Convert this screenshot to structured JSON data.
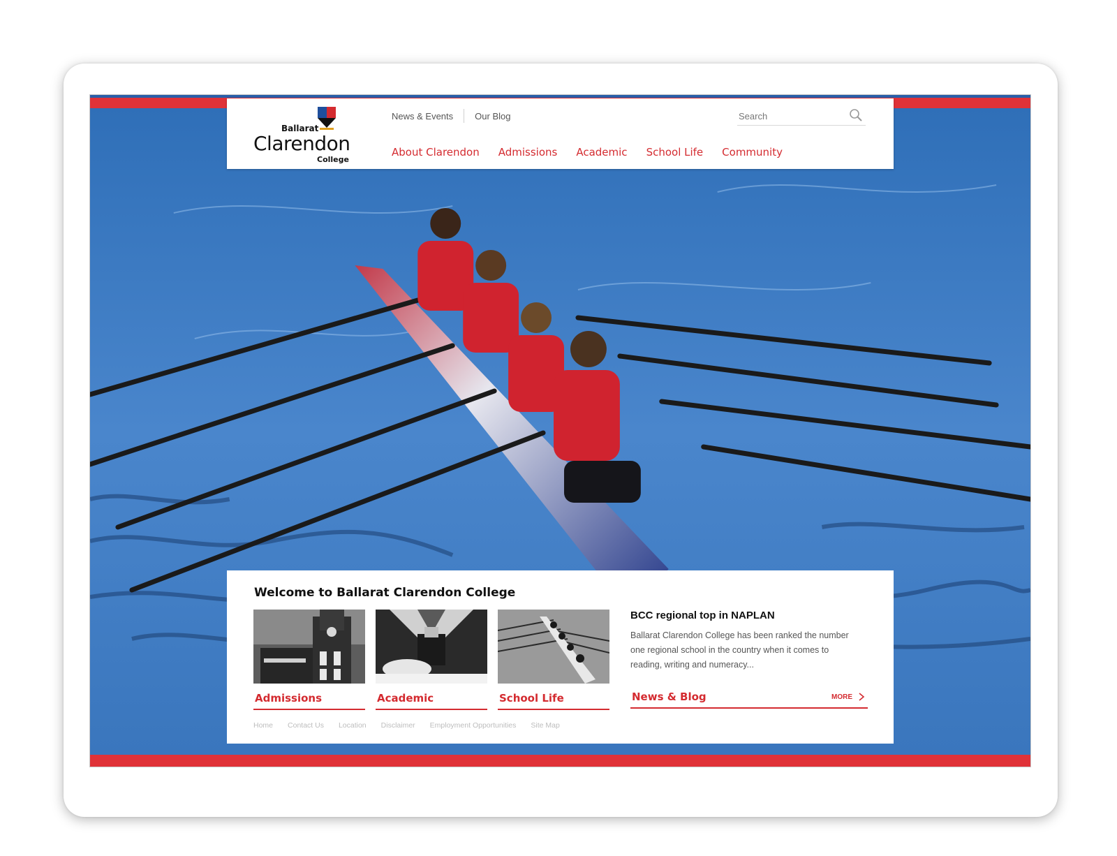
{
  "logo": {
    "line1": "Ballarat",
    "line2": "Clarendon",
    "line3": "College",
    "colors": {
      "shield_red": "#d42b30",
      "shield_blue": "#1f4f9c",
      "shield_black": "#111111",
      "shield_gold": "#e0a020"
    }
  },
  "header": {
    "util_links": [
      "News & Events",
      "Our Blog"
    ],
    "search": {
      "placeholder": "Search",
      "icon": "magnifier-icon"
    },
    "main_nav": [
      "About Clarendon",
      "Admissions",
      "Academic",
      "School Life",
      "Community"
    ]
  },
  "hero": {
    "description_icon": "rowing-photo"
  },
  "content": {
    "welcome": "Welcome to Ballarat Clarendon College",
    "tiles": [
      {
        "label": "Admissions",
        "image": "building-photo"
      },
      {
        "label": "Academic",
        "image": "student-blazer-photo"
      },
      {
        "label": "School Life",
        "image": "rowing-team-photo"
      }
    ],
    "news": {
      "title": "BCC regional top in NAPLAN",
      "body": "Ballarat Clarendon College has been ranked the number one regional school in the country when it comes to reading, writing and numeracy...",
      "label": "News & Blog",
      "more": "MORE",
      "more_icon": "chevron-right-icon"
    }
  },
  "footer": {
    "links": [
      "Home",
      "Contact Us",
      "Location",
      "Disclaimer",
      "Employment Opportunities",
      "Site Map"
    ]
  },
  "colors": {
    "brand_red": "#e03238",
    "text_red": "#d42b30",
    "water": "#3f78c2",
    "top_rule": "#2a5ea8"
  }
}
